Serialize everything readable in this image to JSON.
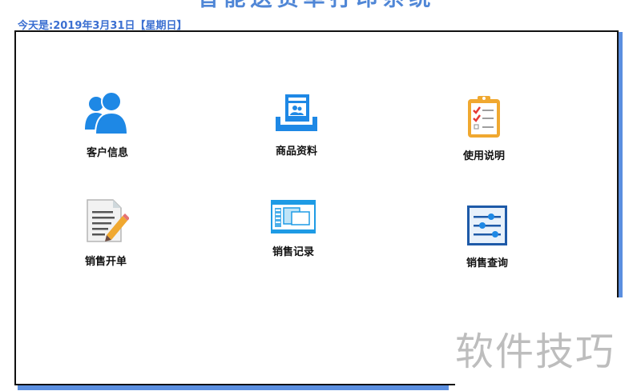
{
  "app": {
    "title": "智能送货单打印系统",
    "date_line": "今天是:2019年3月31日【星期日】"
  },
  "menu": {
    "customer_info": {
      "label": "客户信息",
      "icon": "users-icon"
    },
    "product_data": {
      "label": "商品资料",
      "icon": "product-catalog-icon"
    },
    "instructions": {
      "label": "使用说明",
      "icon": "clipboard-checklist-icon"
    },
    "sales_order": {
      "label": "销售开单",
      "icon": "document-edit-icon"
    },
    "sales_records": {
      "label": "销售记录",
      "icon": "window-records-icon"
    },
    "sales_query": {
      "label": "销售查询",
      "icon": "sliders-icon"
    }
  },
  "watermark": {
    "text": "软件技巧"
  },
  "colors": {
    "accent": "#4f86d6",
    "icon_blue": "#1e88e5",
    "panel_shadow": "#5b8fe0",
    "border": "#111111"
  }
}
